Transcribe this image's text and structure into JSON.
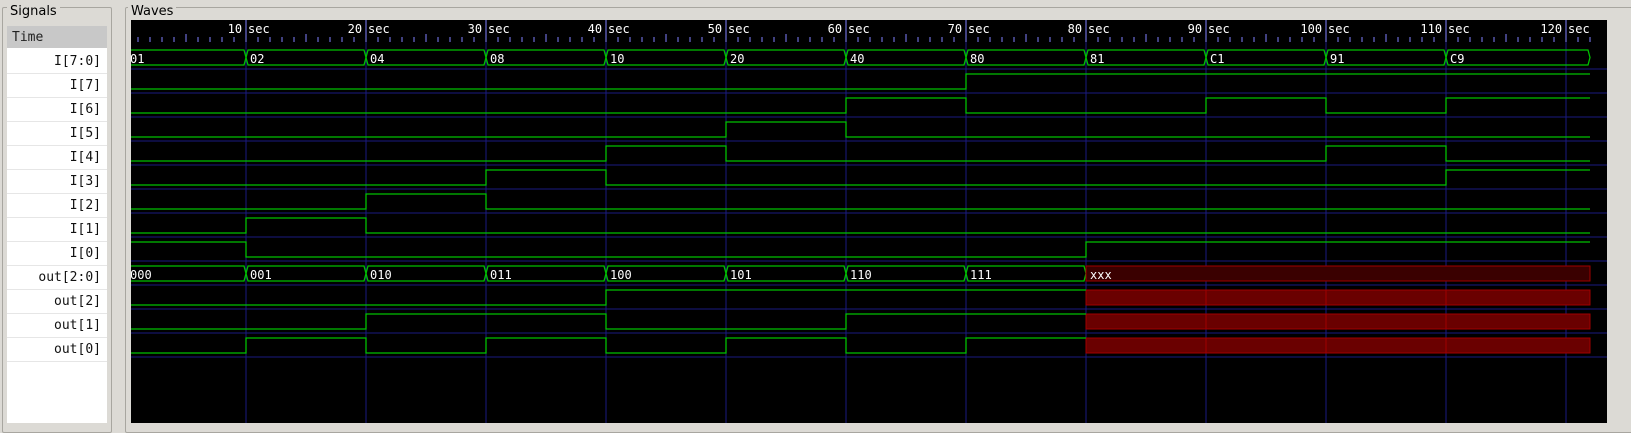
{
  "panels": {
    "signals_title": "Signals",
    "waves_title": "Waves"
  },
  "time_label": "Time",
  "time_unit": "sec",
  "time_ticks": [
    10,
    20,
    30,
    40,
    50,
    60,
    70,
    80,
    90,
    100,
    110,
    120
  ],
  "signals": [
    "I[7:0]",
    "I[7]",
    "I[6]",
    "I[5]",
    "I[4]",
    "I[3]",
    "I[2]",
    "I[1]",
    "I[0]",
    "out[2:0]",
    "out[2]",
    "out[1]",
    "out[0]"
  ],
  "buses": {
    "I[7:0]": [
      "01",
      "02",
      "04",
      "08",
      "10",
      "20",
      "40",
      "80",
      "81",
      "C1",
      "91",
      "C9"
    ],
    "out[2:0]": [
      "000",
      "001",
      "010",
      "011",
      "100",
      "101",
      "110",
      "111",
      "xxx"
    ]
  },
  "bits": {
    "I[7]": [
      0,
      0,
      0,
      0,
      0,
      0,
      0,
      1,
      1,
      1,
      1,
      1
    ],
    "I[6]": [
      0,
      0,
      0,
      0,
      0,
      0,
      1,
      0,
      0,
      1,
      0,
      1
    ],
    "I[5]": [
      0,
      0,
      0,
      0,
      0,
      1,
      0,
      0,
      0,
      0,
      0,
      0
    ],
    "I[4]": [
      0,
      0,
      0,
      0,
      1,
      0,
      0,
      0,
      0,
      0,
      1,
      0
    ],
    "I[3]": [
      0,
      0,
      0,
      1,
      0,
      0,
      0,
      0,
      0,
      0,
      0,
      1
    ],
    "I[2]": [
      0,
      0,
      1,
      0,
      0,
      0,
      0,
      0,
      0,
      0,
      0,
      0
    ],
    "I[1]": [
      0,
      1,
      0,
      0,
      0,
      0,
      0,
      0,
      0,
      0,
      0,
      0
    ],
    "I[0]": [
      1,
      0,
      0,
      0,
      0,
      0,
      0,
      0,
      1,
      1,
      1,
      1
    ],
    "out[2]": [
      0,
      0,
      0,
      0,
      1,
      1,
      1,
      1,
      "x",
      "x",
      "x",
      "x"
    ],
    "out[1]": [
      0,
      0,
      1,
      1,
      0,
      0,
      1,
      1,
      "x",
      "x",
      "x",
      "x"
    ],
    "out[0]": [
      0,
      1,
      0,
      1,
      0,
      1,
      0,
      1,
      "x",
      "x",
      "x",
      "x"
    ]
  },
  "colors": {
    "wave": "#00c000",
    "unknown": "#a00000",
    "grid": "#1a1a80",
    "background": "#000000",
    "text": "#ffffff"
  }
}
